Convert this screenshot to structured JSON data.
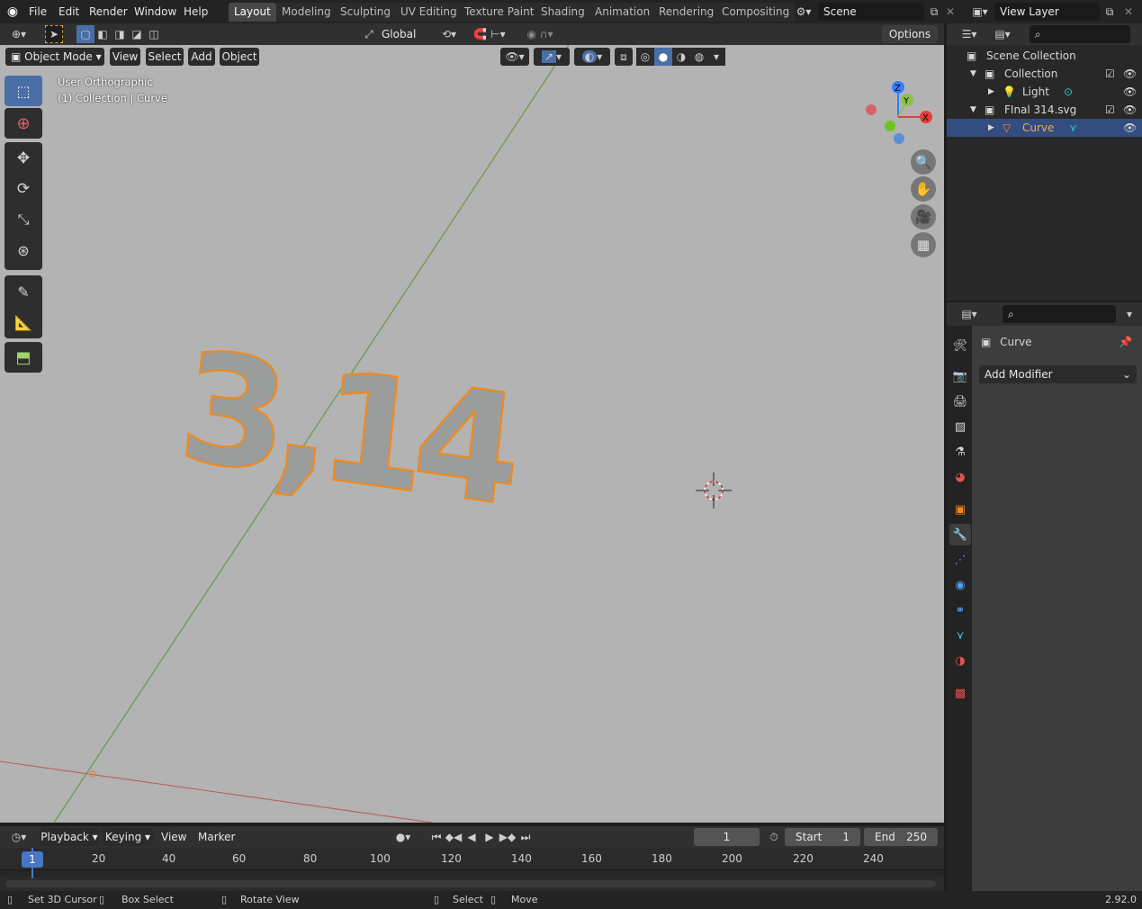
{
  "menu": {
    "file": "File",
    "edit": "Edit",
    "render": "Render",
    "window": "Window",
    "help": "Help"
  },
  "workspaces": [
    "Layout",
    "Modeling",
    "Sculpting",
    "UV Editing",
    "Texture Paint",
    "Shading",
    "Animation",
    "Rendering",
    "Compositing"
  ],
  "active_workspace": "Layout",
  "scene_name": "Scene",
  "view_layer_name": "View Layer",
  "viewport_header": {
    "mode": "Object Mode",
    "view": "View",
    "select": "Select",
    "add": "Add",
    "object": "Object",
    "transform_orientation": "Global",
    "options": "Options"
  },
  "viewport_overlay": {
    "view_name": "User Orthographic",
    "collection_info": "(1) Collection | Curve",
    "object_text": "3,14"
  },
  "gizmo": {
    "x": "X",
    "y": "Y",
    "z": "Z"
  },
  "outliner": {
    "rows": [
      {
        "label": "Scene Collection",
        "indent": 0
      },
      {
        "label": "Collection",
        "indent": 1
      },
      {
        "label": "Light",
        "indent": 2
      },
      {
        "label": "FInal 314.svg",
        "indent": 1
      },
      {
        "label": "Curve",
        "indent": 2
      }
    ]
  },
  "properties": {
    "object_name": "Curve",
    "add_modifier": "Add Modifier"
  },
  "timeline": {
    "playback": "Playback",
    "keying": "Keying",
    "view": "View",
    "marker": "Marker",
    "current_frame": "1",
    "start_label": "Start",
    "start_value": "1",
    "end_label": "End",
    "end_value": "250",
    "ticks": [
      "1",
      "20",
      "40",
      "60",
      "80",
      "100",
      "120",
      "140",
      "160",
      "180",
      "200",
      "220",
      "240"
    ]
  },
  "status": {
    "set_cursor": "Set 3D Cursor",
    "box_select": "Box Select",
    "rotate_view": "Rotate View",
    "select": "Select",
    "move": "Move",
    "version": "2.92.0"
  },
  "colors": {
    "selection_outline": "#f08a1c",
    "active_tab": "#4a6ea6",
    "selected_row": "#334d80"
  }
}
